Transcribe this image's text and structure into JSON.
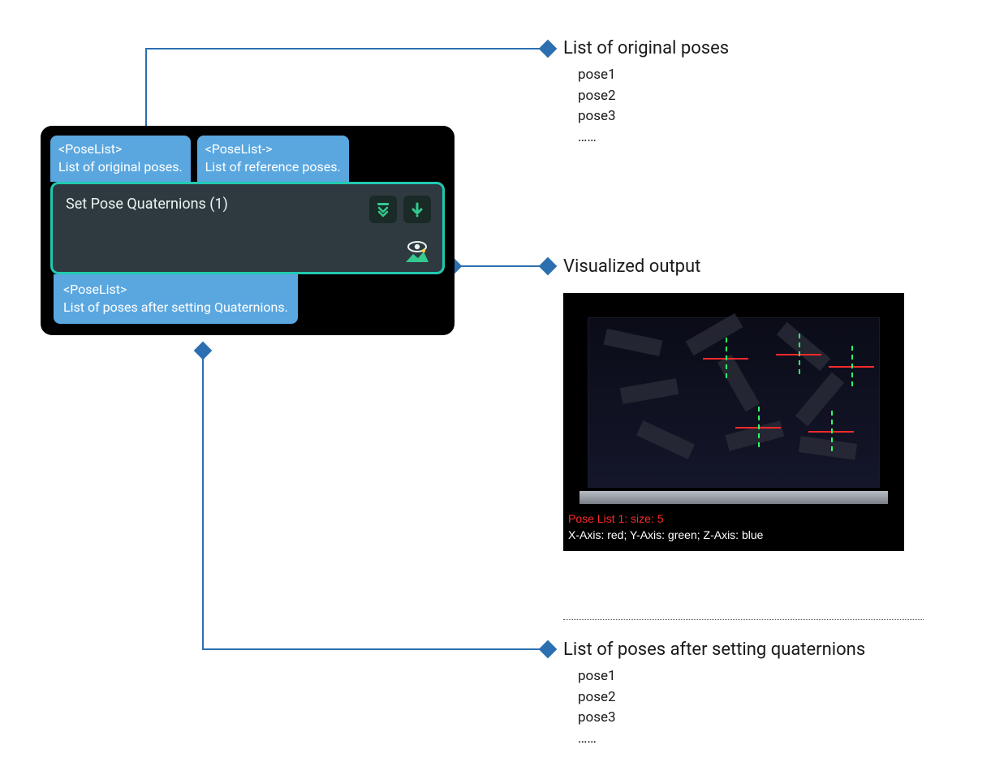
{
  "node": {
    "in_port_1": {
      "type": "<PoseList>",
      "desc": "List of original poses."
    },
    "in_port_2": {
      "type": "<PoseList->",
      "desc": "List of reference poses."
    },
    "title": "Set Pose Quaternions (1)",
    "out_port": {
      "type": "<PoseList>",
      "desc": "List of poses after setting Quaternions."
    }
  },
  "callouts": {
    "c1": {
      "title": "List of original poses",
      "items": [
        "pose1",
        "pose2",
        "pose3",
        "……"
      ]
    },
    "c2": {
      "title": "Visualized output"
    },
    "c3": {
      "title": "List of poses after setting quaternions",
      "items": [
        "pose1",
        "pose2",
        "pose3",
        "……"
      ]
    }
  },
  "viz": {
    "line1": "Pose List 1: size: 5",
    "line2": "X-Axis: red; Y-Axis: green; Z-Axis: blue"
  },
  "colors": {
    "port_bg": "#5aa7e0",
    "node_bg": "#2f3a40",
    "node_border": "#21c9b1",
    "icon_green": "#33c98f",
    "connector": "#2b6fb0"
  }
}
